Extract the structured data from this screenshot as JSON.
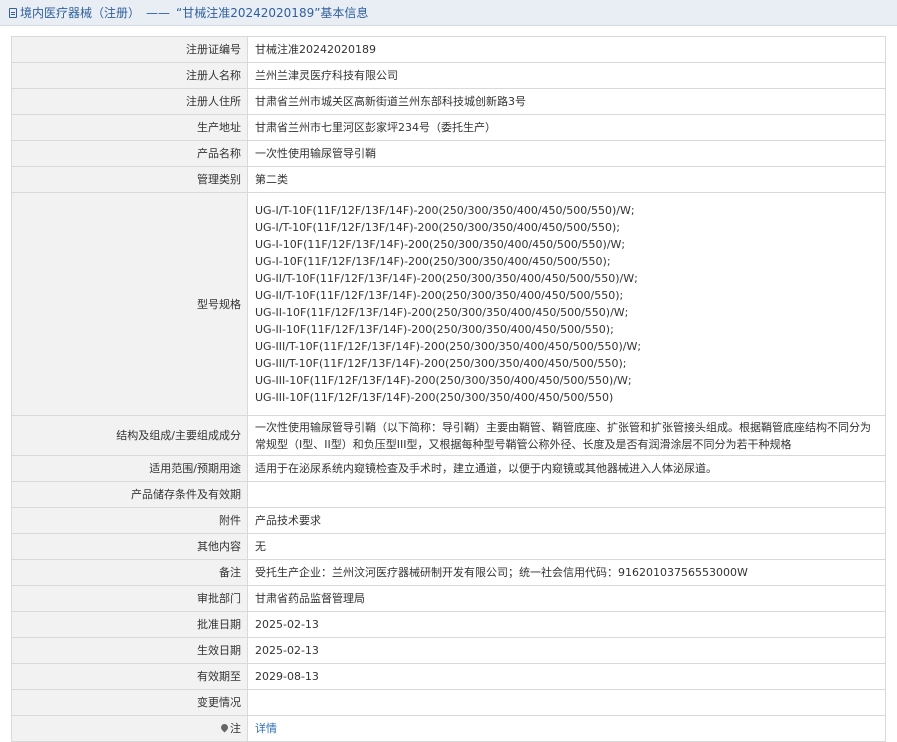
{
  "header": {
    "title": "境内医疗器械（注册）",
    "separator": "——",
    "subtitle": "“甘械注准20242020189”基本信息"
  },
  "fields": {
    "registration_number": {
      "label": "注册证编号",
      "value": "甘械注准20242020189"
    },
    "registrant_name": {
      "label": "注册人名称",
      "value": "兰州兰津灵医疗科技有限公司"
    },
    "registrant_address": {
      "label": "注册人住所",
      "value": "甘肃省兰州市城关区高新街道兰州东部科技城创新路3号"
    },
    "production_address": {
      "label": "生产地址",
      "value": "甘肃省兰州市七里河区彭家坪234号（委托生产）"
    },
    "product_name": {
      "label": "产品名称",
      "value": "一次性使用输尿管导引鞘"
    },
    "management_class": {
      "label": "管理类别",
      "value": "第二类"
    },
    "model_spec": {
      "label": "型号规格",
      "lines": [
        "UG-I/T-10F(11F/12F/13F/14F)-200(250/300/350/400/450/500/550)/W;",
        "UG-I/T-10F(11F/12F/13F/14F)-200(250/300/350/400/450/500/550);",
        "UG-I-10F(11F/12F/13F/14F)-200(250/300/350/400/450/500/550)/W;",
        "UG-I-10F(11F/12F/13F/14F)-200(250/300/350/400/450/500/550);",
        "UG-II/T-10F(11F/12F/13F/14F)-200(250/300/350/400/450/500/550)/W;",
        "UG-II/T-10F(11F/12F/13F/14F)-200(250/300/350/400/450/500/550);",
        "UG-II-10F(11F/12F/13F/14F)-200(250/300/350/400/450/500/550)/W;",
        "UG-II-10F(11F/12F/13F/14F)-200(250/300/350/400/450/500/550);",
        "UG-III/T-10F(11F/12F/13F/14F)-200(250/300/350/400/450/500/550)/W;",
        "UG-III/T-10F(11F/12F/13F/14F)-200(250/300/350/400/450/500/550);",
        "UG-III-10F(11F/12F/13F/14F)-200(250/300/350/400/450/500/550)/W;",
        "UG-III-10F(11F/12F/13F/14F)-200(250/300/350/400/450/500/550)"
      ]
    },
    "structure": {
      "label": "结构及组成/主要组成成分",
      "value": "一次性使用输尿管导引鞘（以下简称：导引鞘）主要由鞘管、鞘管底座、扩张管和扩张管接头组成。根据鞘管底座结构不同分为常规型（I型、II型）和负压型III型，又根据每种型号鞘管公称外径、长度及是否有润滑涂层不同分为若干种规格"
    },
    "intended_use": {
      "label": "适用范围/预期用途",
      "value": "适用于在泌尿系统内窥镜检查及手术时，建立通道，以便于内窥镜或其他器械进入人体泌尿道。"
    },
    "storage": {
      "label": "产品储存条件及有效期",
      "value": ""
    },
    "attachment": {
      "label": "附件",
      "value": "产品技术要求"
    },
    "other": {
      "label": "其他内容",
      "value": "无"
    },
    "remarks": {
      "label": "备注",
      "value": "受托生产企业：兰州汶河医疗器械研制开发有限公司；统一社会信用代码：91620103756553000W"
    },
    "approval_dept": {
      "label": "审批部门",
      "value": "甘肃省药品监督管理局"
    },
    "approval_date": {
      "label": "批准日期",
      "value": "2025-02-13"
    },
    "effective_date": {
      "label": "生效日期",
      "value": "2025-02-13"
    },
    "expiry_date": {
      "label": "有效期至",
      "value": "2029-08-13"
    },
    "change_info": {
      "label": "变更情况",
      "value": ""
    },
    "note": {
      "label": "注",
      "link": "详情"
    }
  },
  "colors": {
    "header_bg": "#e9eef4",
    "header_text": "#2f5f9e",
    "label_bg": "#f2f2f2",
    "border": "#d9d9d9",
    "link": "#2f6fb4"
  }
}
